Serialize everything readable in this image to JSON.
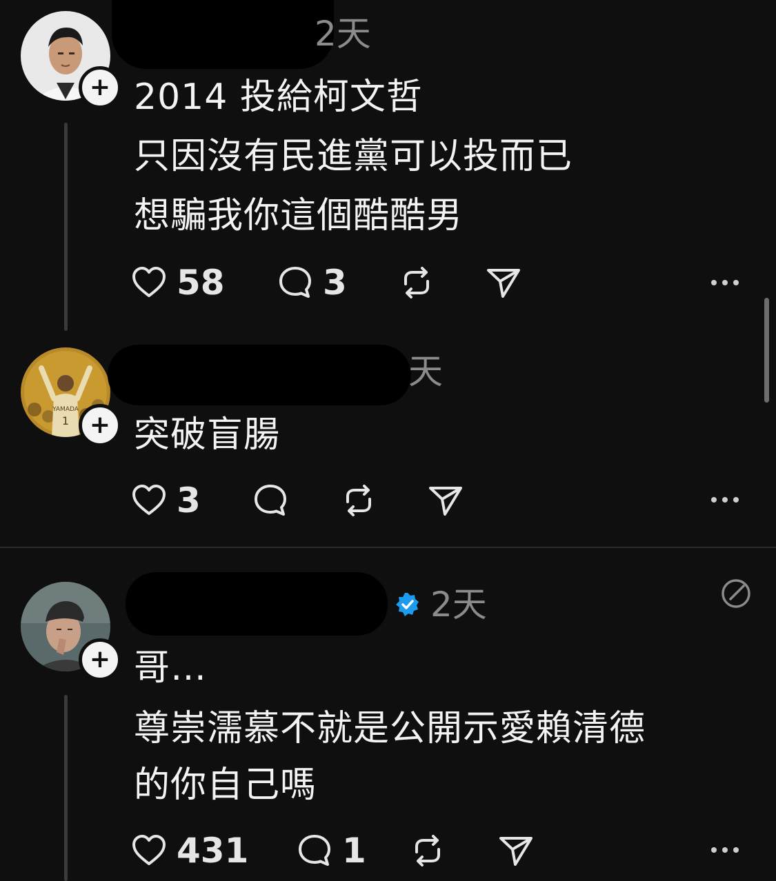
{
  "posts": [
    {
      "time": "2天",
      "lines": [
        "2014 投給柯文哲",
        "只因沒有民進黨可以投而已",
        "想騙我你這個酷酷男"
      ],
      "likes": "58",
      "replies": "3"
    },
    {
      "time": "天",
      "lines": [
        "突破盲腸"
      ],
      "likes": "3",
      "replies": ""
    },
    {
      "time": "2天",
      "lines": [
        "哥…",
        "尊崇濡慕不就是公開示愛賴清德",
        "的你自己嗎"
      ],
      "likes": "431",
      "replies": "1",
      "verified": true
    }
  ],
  "icons": {
    "like": "heart-icon",
    "reply": "comment-icon",
    "repost": "repost-icon",
    "share": "send-icon",
    "more": "more-icon",
    "follow": "plus-icon",
    "verified": "verified-badge-icon",
    "edited": "edited-icon"
  },
  "colors": {
    "background": "#0f0f0f",
    "text": "#f3f3f3",
    "muted": "#8b8b8b",
    "verified": "#1d9bf0"
  }
}
